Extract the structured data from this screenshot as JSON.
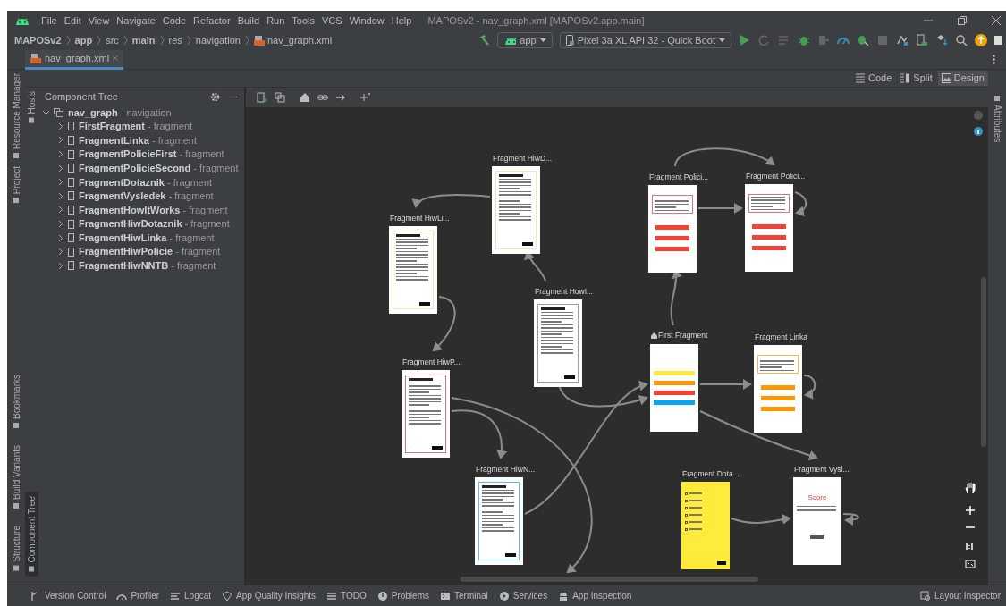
{
  "window": {
    "title": "MAPOSv2 - nav_graph.xml [MAPOSv2.app.main]"
  },
  "menu": [
    "File",
    "Edit",
    "View",
    "Navigate",
    "Code",
    "Refactor",
    "Build",
    "Run",
    "Tools",
    "VCS",
    "Window",
    "Help"
  ],
  "breadcrumb": [
    {
      "label": "MAPOSv2",
      "bold": true
    },
    {
      "label": "app",
      "bold": true
    },
    {
      "label": "src",
      "bold": false
    },
    {
      "label": "main",
      "bold": true
    },
    {
      "label": "res",
      "bold": false
    },
    {
      "label": "navigation",
      "bold": false
    },
    {
      "label": "nav_graph.xml",
      "bold": false
    }
  ],
  "run_config": {
    "label": "app"
  },
  "device": {
    "label": "Pixel 3a XL API 32 - Quick Boot"
  },
  "editor_tabs": [
    {
      "label": "nav_graph.xml",
      "selected": true
    }
  ],
  "view_modes": [
    {
      "label": "Code",
      "selected": false
    },
    {
      "label": "Split",
      "selected": false
    },
    {
      "label": "Design",
      "selected": true
    }
  ],
  "left_tool_windows": {
    "top": [
      {
        "label": "Resource Manager"
      },
      {
        "label": "Project"
      }
    ],
    "bottom": [
      {
        "label": "Bookmarks"
      },
      {
        "label": "Build Variants"
      },
      {
        "label": "Structure"
      }
    ]
  },
  "hosts_stripe": {
    "top": [
      {
        "label": "Hosts",
        "selected": false
      }
    ],
    "bottom": [
      {
        "label": "Component Tree",
        "selected": true
      }
    ]
  },
  "component_tree": {
    "title": "Component Tree",
    "root": {
      "text": "**nav_graph** - navigation",
      "expanded": true,
      "children": [
        {
          "text": "**FirstFragment** - fragment",
          "expanded": false
        },
        {
          "text": "**FragmentLinka** - fragment",
          "expanded": false
        },
        {
          "text": "**FragmentPolicieFirst** - fragment",
          "expanded": false
        },
        {
          "text": "**FragmentPolicieSecond** - fragment",
          "expanded": false
        },
        {
          "text": "**FragmentDotaznik** - fragment",
          "expanded": false
        },
        {
          "text": "**FragmentVysledek** - fragment",
          "expanded": false
        },
        {
          "text": "**FragmentHowItWorks** - fragment",
          "expanded": false
        },
        {
          "text": "**FragmentHiwDotaznik** - fragment",
          "expanded": false
        },
        {
          "text": "**FragmentHiwLinka** - fragment",
          "expanded": false
        },
        {
          "text": "**FragmentHiwPolicie** - fragment",
          "expanded": false
        },
        {
          "text": "**FragmentHiwNNTB** - fragment",
          "expanded": false
        }
      ]
    }
  },
  "right_tool_windows": [
    {
      "label": "Attributes"
    }
  ],
  "graph": {
    "nodes": [
      {
        "label": "Fragment HiwD...",
        "start": false,
        "preview": {
          "kind": "article",
          "color": "#f3e3c0"
        }
      },
      {
        "label": "Fragment HiwLi...",
        "start": false,
        "preview": {
          "kind": "article",
          "color": "#f3e3c0"
        }
      },
      {
        "label": "Fragment HowI...",
        "start": false,
        "preview": {
          "kind": "article",
          "color": "#9e9e9e"
        }
      },
      {
        "label": "Fragment Polici...",
        "start": false,
        "preview": {
          "kind": "menu",
          "color": "#e57373",
          "buttons": [
            {
              "color": "#f44336"
            },
            {
              "color": "#f44336"
            },
            {
              "color": "#f44336"
            }
          ]
        }
      },
      {
        "label": "Fragment Polici...",
        "start": false,
        "preview": {
          "kind": "menu",
          "color": "#e57373",
          "buttons": [
            {
              "color": "#f44336"
            },
            {
              "color": "#f44336"
            },
            {
              "color": "#f44336"
            }
          ]
        }
      },
      {
        "label": "First Fragment",
        "start": true,
        "preview": {
          "kind": "buttons",
          "buttons": [
            {
              "color": "#ffeb3b"
            },
            {
              "color": "#ff9800"
            },
            {
              "color": "#f44336"
            },
            {
              "color": "#03a9f4"
            }
          ]
        }
      },
      {
        "label": "Fragment Linka",
        "start": false,
        "preview": {
          "kind": "menu",
          "color": "#ffb74d",
          "buttons": [
            {
              "color": "#ff9800"
            },
            {
              "color": "#ff9800"
            },
            {
              "color": "#ff9800"
            }
          ]
        }
      },
      {
        "label": "Fragment HiwP...",
        "start": false,
        "preview": {
          "kind": "article",
          "color": "#e57373"
        }
      },
      {
        "label": "Fragment HiwN...",
        "start": false,
        "preview": {
          "kind": "article",
          "color": "#64b5f6"
        }
      },
      {
        "label": "Fragment Dota...",
        "start": false,
        "preview": {
          "kind": "quiz",
          "color": "#ffeb3b"
        }
      },
      {
        "label": "Fragment Vysl...",
        "start": false,
        "preview": {
          "kind": "result",
          "title": "Score"
        }
      }
    ]
  },
  "bottom_tools": {
    "left": [
      {
        "label": "Version Control"
      },
      {
        "label": "Profiler"
      },
      {
        "label": "Logcat"
      },
      {
        "label": "App Quality Insights"
      },
      {
        "label": "TODO"
      },
      {
        "label": "Problems"
      },
      {
        "label": "Terminal"
      },
      {
        "label": "Services"
      },
      {
        "label": "App Inspection"
      }
    ],
    "right": [
      {
        "label": "Layout Inspector"
      }
    ]
  }
}
